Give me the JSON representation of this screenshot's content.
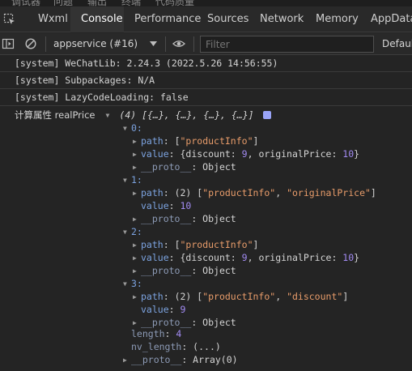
{
  "top_strip": [
    "调试器",
    "问题",
    "输出",
    "终端",
    "代码质量"
  ],
  "tabs": [
    "Wxml",
    "Console",
    "Performance",
    "Sources",
    "Network",
    "Memory",
    "AppData"
  ],
  "toolbar": {
    "context": "appservice (#16)",
    "filter_placeholder": "Filter",
    "levels": "Default"
  },
  "messages": [
    "[system] WeChatLib: 2.24.3 (2022.5.26 14:56:55)",
    "[system] Subpackages: N/A",
    "[system] LazyCodeLoading: false"
  ],
  "log": {
    "label": "计算属性 realPrice",
    "array_summary": "(4) [{…}, {…}, {…}, {…}]",
    "items": [
      {
        "index": "0:",
        "rows": [
          {
            "key": "path",
            "parts": [
              [
                "p",
                "["
              ],
              [
                "s",
                "\"productInfo\""
              ],
              [
                "p",
                "]"
              ]
            ]
          },
          {
            "key": "value",
            "parts": [
              [
                "p",
                "{discount: "
              ],
              [
                "n",
                "9"
              ],
              [
                "p",
                ", originalPrice: "
              ],
              [
                "n",
                "10"
              ],
              [
                "p",
                "}"
              ]
            ]
          },
          {
            "key": "__proto__",
            "parts": [
              [
                "p",
                "Object"
              ]
            ]
          }
        ]
      },
      {
        "index": "1:",
        "rows": [
          {
            "key": "path",
            "parts": [
              [
                "p",
                "(2) ["
              ],
              [
                "s",
                "\"productInfo\""
              ],
              [
                "p",
                ", "
              ],
              [
                "s",
                "\"originalPrice\""
              ],
              [
                "p",
                "]"
              ]
            ]
          },
          {
            "key": "value",
            "parts": [
              [
                "n",
                "10"
              ]
            ]
          },
          {
            "key": "__proto__",
            "parts": [
              [
                "p",
                "Object"
              ]
            ]
          }
        ]
      },
      {
        "index": "2:",
        "rows": [
          {
            "key": "path",
            "parts": [
              [
                "p",
                "["
              ],
              [
                "s",
                "\"productInfo\""
              ],
              [
                "p",
                "]"
              ]
            ]
          },
          {
            "key": "value",
            "parts": [
              [
                "p",
                "{discount: "
              ],
              [
                "n",
                "9"
              ],
              [
                "p",
                ", originalPrice: "
              ],
              [
                "n",
                "10"
              ],
              [
                "p",
                "}"
              ]
            ]
          },
          {
            "key": "__proto__",
            "parts": [
              [
                "p",
                "Object"
              ]
            ]
          }
        ]
      },
      {
        "index": "3:",
        "rows": [
          {
            "key": "path",
            "parts": [
              [
                "p",
                "(2) ["
              ],
              [
                "s",
                "\"productInfo\""
              ],
              [
                "p",
                ", "
              ],
              [
                "s",
                "\"discount\""
              ],
              [
                "p",
                "]"
              ]
            ]
          },
          {
            "key": "value",
            "parts": [
              [
                "n",
                "9"
              ]
            ]
          },
          {
            "key": "__proto__",
            "parts": [
              [
                "p",
                "Object"
              ]
            ]
          }
        ]
      }
    ],
    "length_key": "length",
    "length_value": "4",
    "nv_length_key": "nv_length",
    "nv_length_value": "(...)",
    "proto_key": "__proto__",
    "proto_value": "Array(0)"
  },
  "colors": {
    "background": "#242424",
    "key": "#7ca3e0",
    "string": "#e89c6a",
    "number": "#a28bf2"
  }
}
